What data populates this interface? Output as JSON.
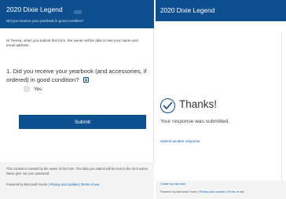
{
  "form": {
    "title": "2020 Dixie Legend",
    "subtitle": "Did you receive your yearbook in good condition?",
    "notice": "Hi Teresa, when you submit this form, the owner will be able to see your name and email address.",
    "question": "1. Did you receive your yearbook (and accessories, if ordered) in good condition?",
    "question_icon": "immersive-reader-icon",
    "options": [
      {
        "label": "Yes"
      }
    ],
    "submit_label": "Submit",
    "disclaimer": "This content is created by the owner of the form. The data you submit will be sent to the form owner. Never give out your password.",
    "footer": {
      "powered_prefix": "Powered by Microsoft Forms |",
      "privacy": "Privacy and cookies",
      "separator": "|",
      "terms": "Terms of use"
    }
  },
  "confirmation": {
    "title": "2020 Dixie Legend",
    "heading": "Thanks!",
    "message": "Your response was submitted.",
    "another_link": "Submit another response",
    "footer": {
      "create": "Create my own form",
      "powered_prefix": "Powered by Microsoft Forms |",
      "privacy": "Privacy and cookies",
      "separator": "|",
      "terms": "Terms of use"
    }
  },
  "colors": {
    "brand": "#0e4f8f",
    "link": "#0e5fae",
    "footer_bg": "#f4f4f4"
  }
}
